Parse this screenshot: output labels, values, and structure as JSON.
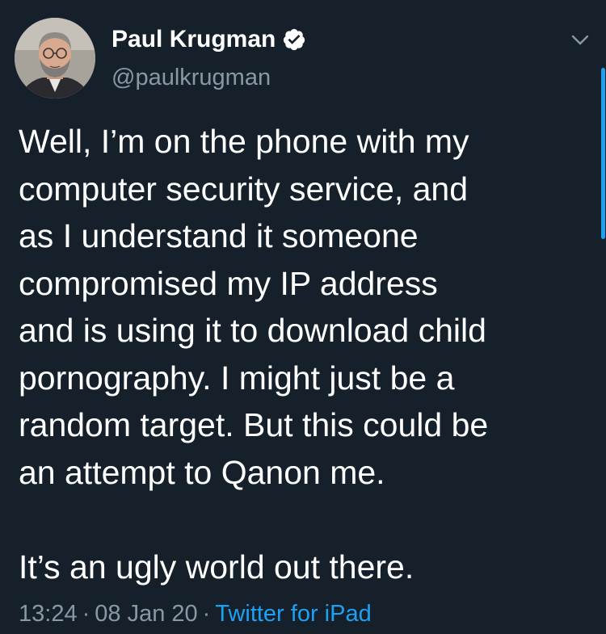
{
  "author": {
    "display_name": "Paul Krugman",
    "handle": "@paulkrugman",
    "verified": true
  },
  "tweet": {
    "lines_para1": [
      "Well, I’m on the phone with my",
      "computer security service, and",
      "as I understand it someone",
      "compromised my IP address",
      "and is using it to download child",
      "pornography. I might just be a",
      "random target. But this could be",
      "an attempt to Qanon me."
    ],
    "lines_para2": [
      "It’s an ugly world out there."
    ],
    "time": "13:24",
    "date": "08 Jan 20",
    "separator": "·",
    "source": "Twitter for iPad"
  },
  "colors": {
    "background": "#15202b",
    "text": "#ffffff",
    "secondary_text": "#8899a6",
    "accent": "#1da1f2"
  },
  "icons": {
    "verified": "verified-badge-icon",
    "caret": "chevron-down-icon"
  }
}
